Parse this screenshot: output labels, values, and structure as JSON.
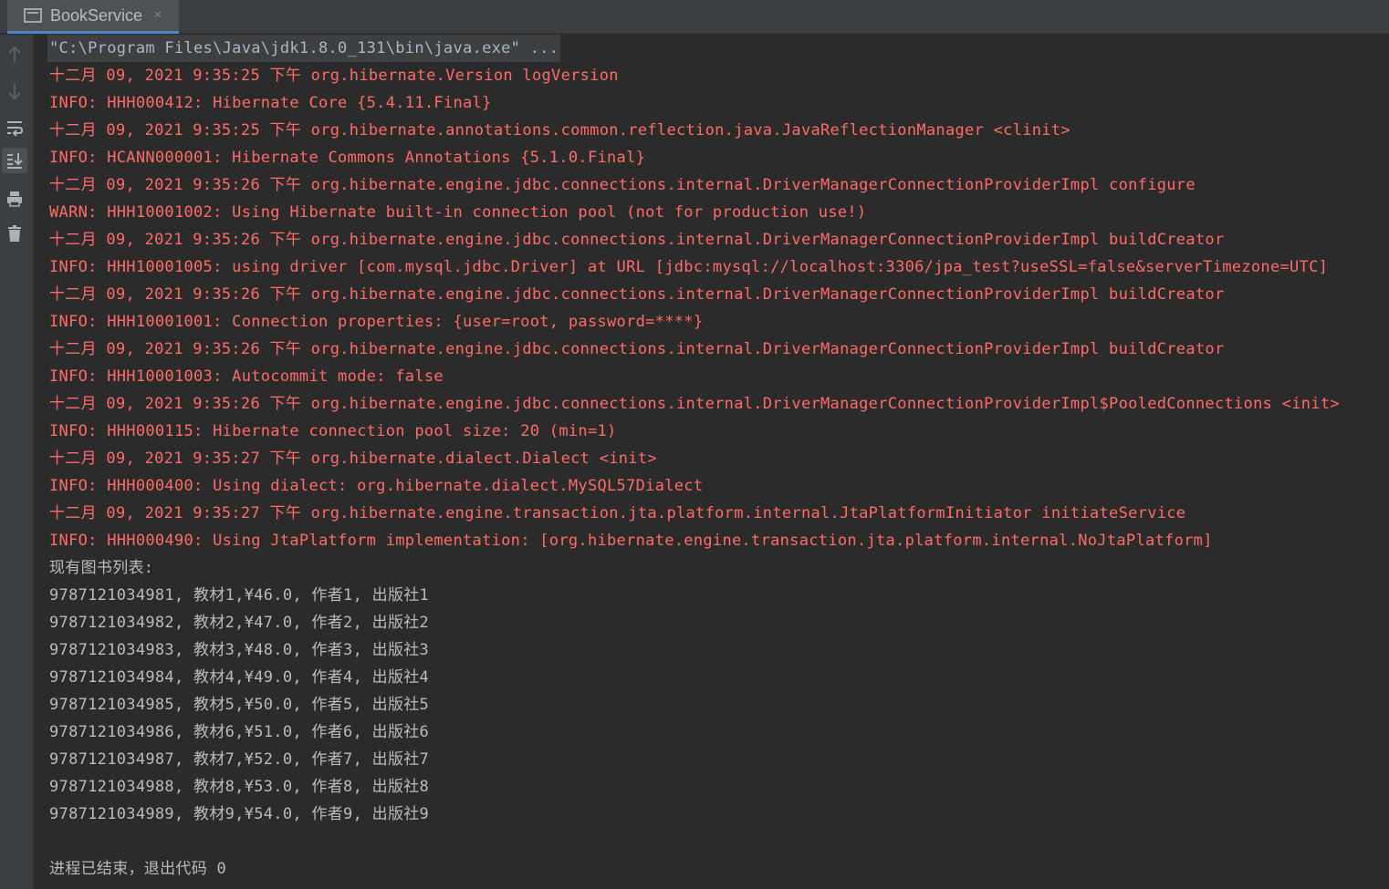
{
  "tab": {
    "title": "BookService",
    "close_symbol": "×",
    "icon": "console-window-icon"
  },
  "toolbar": {
    "icons": [
      "arrow-up-icon",
      "arrow-down-icon",
      "soft-wrap-icon",
      "scroll-to-end-icon",
      "print-icon",
      "trash-icon"
    ]
  },
  "colors": {
    "error_text": "#ff6b68",
    "normal_text": "#bbbbbb",
    "background": "#2b2b2b",
    "tab_underline": "#4a88c7"
  },
  "console": {
    "command": "\"C:\\Program Files\\Java\\jdk1.8.0_131\\bin\\java.exe\" ...",
    "log_lines": [
      "十二月 09, 2021 9:35:25 下午 org.hibernate.Version logVersion",
      "INFO: HHH000412: Hibernate Core {5.4.11.Final}",
      "十二月 09, 2021 9:35:25 下午 org.hibernate.annotations.common.reflection.java.JavaReflectionManager <clinit>",
      "INFO: HCANN000001: Hibernate Commons Annotations {5.1.0.Final}",
      "十二月 09, 2021 9:35:26 下午 org.hibernate.engine.jdbc.connections.internal.DriverManagerConnectionProviderImpl configure",
      "WARN: HHH10001002: Using Hibernate built-in connection pool (not for production use!)",
      "十二月 09, 2021 9:35:26 下午 org.hibernate.engine.jdbc.connections.internal.DriverManagerConnectionProviderImpl buildCreator",
      "INFO: HHH10001005: using driver [com.mysql.jdbc.Driver] at URL [jdbc:mysql://localhost:3306/jpa_test?useSSL=false&serverTimezone=UTC]",
      "十二月 09, 2021 9:35:26 下午 org.hibernate.engine.jdbc.connections.internal.DriverManagerConnectionProviderImpl buildCreator",
      "INFO: HHH10001001: Connection properties: {user=root, password=****}",
      "十二月 09, 2021 9:35:26 下午 org.hibernate.engine.jdbc.connections.internal.DriverManagerConnectionProviderImpl buildCreator",
      "INFO: HHH10001003: Autocommit mode: false",
      "十二月 09, 2021 9:35:26 下午 org.hibernate.engine.jdbc.connections.internal.DriverManagerConnectionProviderImpl$PooledConnections <init>",
      "INFO: HHH000115: Hibernate connection pool size: 20 (min=1)",
      "十二月 09, 2021 9:35:27 下午 org.hibernate.dialect.Dialect <init>",
      "INFO: HHH000400: Using dialect: org.hibernate.dialect.MySQL57Dialect",
      "十二月 09, 2021 9:35:27 下午 org.hibernate.engine.transaction.jta.platform.internal.JtaPlatformInitiator initiateService",
      "INFO: HHH000490: Using JtaPlatform implementation: [org.hibernate.engine.transaction.jta.platform.internal.NoJtaPlatform]"
    ],
    "books_header": "现有图书列表:",
    "books": [
      "9787121034981, 教材1,¥46.0, 作者1, 出版社1",
      "9787121034982, 教材2,¥47.0, 作者2, 出版社2",
      "9787121034983, 教材3,¥48.0, 作者3, 出版社3",
      "9787121034984, 教材4,¥49.0, 作者4, 出版社4",
      "9787121034985, 教材5,¥50.0, 作者5, 出版社5",
      "9787121034986, 教材6,¥51.0, 作者6, 出版社6",
      "9787121034987, 教材7,¥52.0, 作者7, 出版社7",
      "9787121034988, 教材8,¥53.0, 作者8, 出版社8",
      "9787121034989, 教材9,¥54.0, 作者9, 出版社9"
    ],
    "exit_message": "进程已结束，退出代码 0"
  }
}
